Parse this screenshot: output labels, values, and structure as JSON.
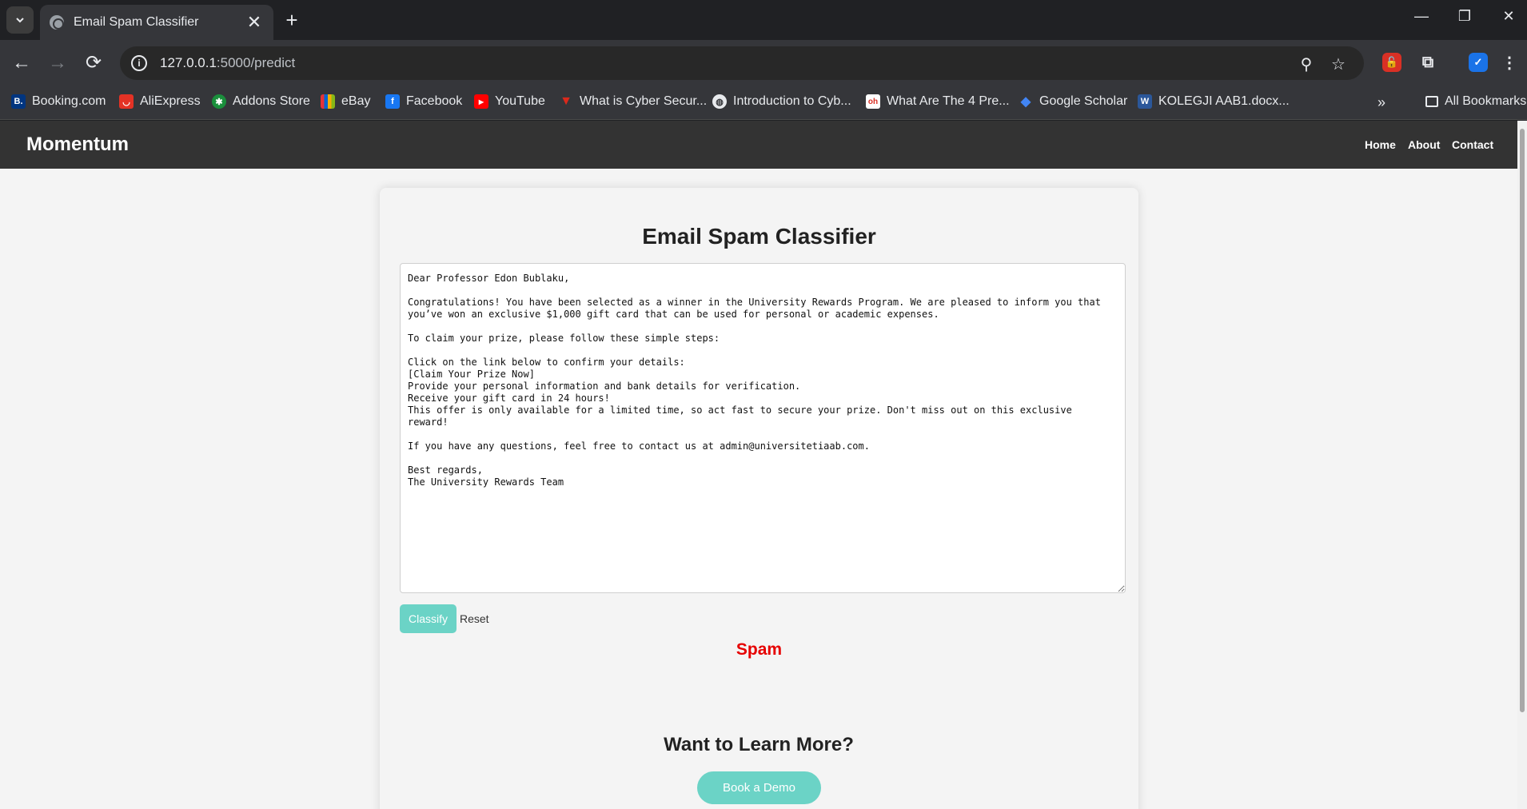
{
  "browser": {
    "tab_title": "Email Spam Classifier",
    "url_host": "127.0.0.1",
    "url_rest": ":5000/predict",
    "bookmarks": [
      {
        "label": "Booking.com",
        "icon": "booking-icon",
        "color": "#003580",
        "glyph": "B."
      },
      {
        "label": "AliExpress",
        "icon": "aliexpress-icon",
        "color": "#e43225",
        "glyph": "◡"
      },
      {
        "label": "Addons Store",
        "icon": "addons-store-icon",
        "color": "#1a8f3c",
        "glyph": "✱"
      },
      {
        "label": "eBay",
        "icon": "ebay-icon",
        "color": "#e53238",
        "glyph": "▤"
      },
      {
        "label": "Facebook",
        "icon": "facebook-icon",
        "color": "#1877f2",
        "glyph": "f"
      },
      {
        "label": "YouTube",
        "icon": "youtube-icon",
        "color": "#ff0000",
        "glyph": "▶"
      },
      {
        "label": "What is Cyber Secur...",
        "icon": "fortinet-icon",
        "color": "#da291c",
        "glyph": "▼"
      },
      {
        "label": "Introduction to Cyb...",
        "icon": "globe-icon",
        "color": "#9aa0a6",
        "glyph": "◍"
      },
      {
        "label": "What Are The 4 Pre...",
        "icon": "oh-icon",
        "color": "#ffffff",
        "glyph": "oh"
      },
      {
        "label": "Google Scholar",
        "icon": "google-scholar-icon",
        "color": "#4285f4",
        "glyph": "◆"
      },
      {
        "label": "KOLEGJI AAB1.docx...",
        "icon": "word-icon",
        "color": "#2b579a",
        "glyph": "W"
      }
    ],
    "all_bookmarks_label": "All Bookmarks"
  },
  "site": {
    "logo": "Momentum",
    "nav": [
      "Home",
      "About",
      "Contact"
    ]
  },
  "classifier": {
    "title": "Email Spam Classifier",
    "email_text": "Dear Professor Edon Bublaku,\n\nCongratulations! You have been selected as a winner in the University Rewards Program. We are pleased to inform you that you’ve won an exclusive $1,000 gift card that can be used for personal or academic expenses.\n\nTo claim your prize, please follow these simple steps:\n\nClick on the link below to confirm your details:\n[Claim Your Prize Now]\nProvide your personal information and bank details for verification.\nReceive your gift card in 24 hours!\nThis offer is only available for a limited time, so act fast to secure your prize. Don't miss out on this exclusive reward!\n\nIf you have any questions, feel free to contact us at admin@universitetiaab.com.\n\nBest regards,\nThe University Rewards Team",
    "classify_label": "Classify",
    "reset_label": "Reset",
    "result": "Spam",
    "result_color": "#e60000",
    "accent_color": "#6bd3c6"
  },
  "cta": {
    "title": "Want to Learn More?",
    "button_label": "Book a Demo"
  }
}
